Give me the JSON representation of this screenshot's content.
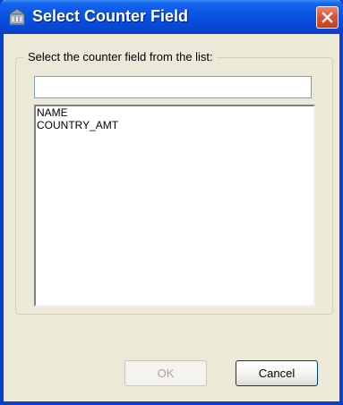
{
  "window": {
    "title": "Select Counter Field",
    "icon": "database-icon",
    "close_icon": "close-icon"
  },
  "group": {
    "legend": "Select the counter field from the list:"
  },
  "filter": {
    "value": "",
    "placeholder": ""
  },
  "fields": {
    "items": [
      "NAME",
      "COUNTRY_AMT"
    ]
  },
  "buttons": {
    "ok": {
      "label": "OK",
      "enabled": false
    },
    "cancel": {
      "label": "Cancel",
      "enabled": true
    }
  },
  "colors": {
    "titlebar": "#0954e2",
    "window_frame": "#0841d0",
    "dialog_bg": "#ece9d8",
    "close_button": "#de5436",
    "disabled_text": "#aca899"
  }
}
